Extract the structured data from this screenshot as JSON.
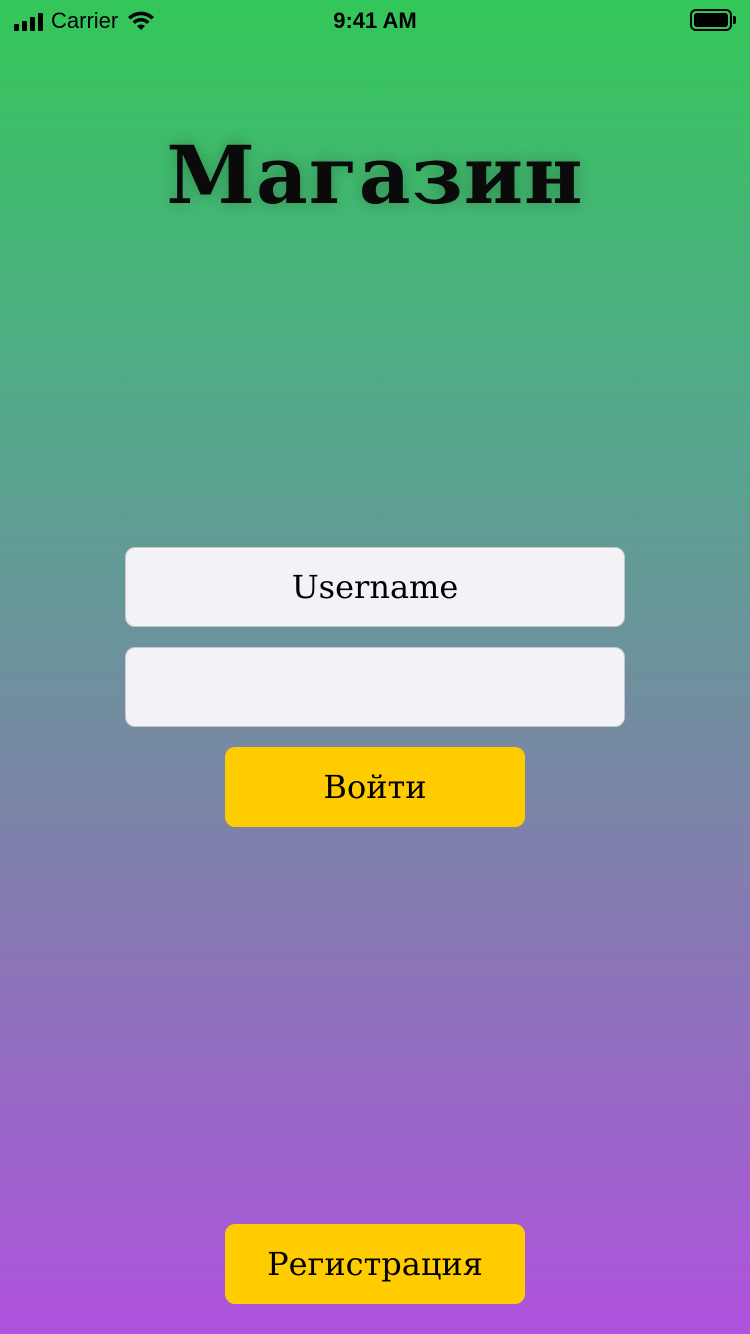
{
  "status_bar": {
    "carrier": "Carrier",
    "time": "9:41 AM",
    "signal_icon": "cellular-signal-icon",
    "wifi_icon": "wifi-icon",
    "battery_icon": "battery-icon",
    "battery_level": 1.0
  },
  "title": "Магазин",
  "login_form": {
    "username_placeholder": "Username",
    "username_value": "",
    "password_placeholder": "",
    "password_value": "",
    "login_label": "Войти"
  },
  "register_label": "Регистрация",
  "colors": {
    "gradient_top": "#34c759",
    "gradient_bottom": "#af52de",
    "button": "#ffcc00",
    "field_background": "#f2f2f7"
  }
}
